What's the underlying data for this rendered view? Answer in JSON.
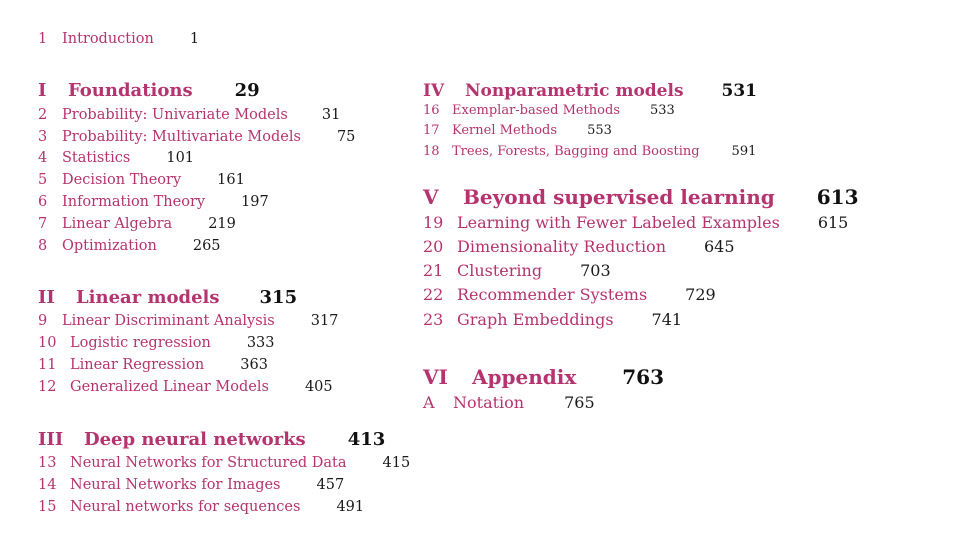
{
  "intro": {
    "num": "1",
    "title": "Introduction",
    "page": "1"
  },
  "parts": {
    "p1": {
      "num": "I",
      "title": "Foundations",
      "page": "29",
      "chapters": [
        {
          "num": "2",
          "title": "Probability: Univariate Models",
          "page": "31"
        },
        {
          "num": "3",
          "title": "Probability: Multivariate Models",
          "page": "75"
        },
        {
          "num": "4",
          "title": "Statistics",
          "page": "101"
        },
        {
          "num": "5",
          "title": "Decision Theory",
          "page": "161"
        },
        {
          "num": "6",
          "title": "Information Theory",
          "page": "197"
        },
        {
          "num": "7",
          "title": "Linear Algebra",
          "page": "219"
        },
        {
          "num": "8",
          "title": "Optimization",
          "page": "265"
        }
      ]
    },
    "p2": {
      "num": "II",
      "title": "Linear models",
      "page": "315",
      "chapters": [
        {
          "num": "9",
          "title": "Linear Discriminant Analysis",
          "page": "317"
        },
        {
          "num": "10",
          "title": "Logistic regression",
          "page": "333"
        },
        {
          "num": "11",
          "title": "Linear Regression",
          "page": "363"
        },
        {
          "num": "12",
          "title": "Generalized Linear Models",
          "page": "405"
        }
      ]
    },
    "p3": {
      "num": "III",
      "title": "Deep neural networks",
      "page": "413",
      "chapters": [
        {
          "num": "13",
          "title": "Neural Networks for Structured Data",
          "page": "415"
        },
        {
          "num": "14",
          "title": "Neural Networks for Images",
          "page": "457"
        },
        {
          "num": "15",
          "title": "Neural networks for sequences",
          "page": "491"
        }
      ]
    },
    "p4": {
      "num": "IV",
      "title": "Nonparametric models",
      "page": "531",
      "chapters": [
        {
          "num": "16",
          "title": "Exemplar-based Methods",
          "page": "533"
        },
        {
          "num": "17",
          "title": "Kernel Methods",
          "page": "553"
        },
        {
          "num": "18",
          "title": "Trees, Forests, Bagging and Boosting",
          "page": "591"
        }
      ]
    },
    "p5": {
      "num": "V",
      "title": "Beyond supervised learning",
      "page": "613",
      "chapters": [
        {
          "num": "19",
          "title": "Learning with Fewer Labeled Examples",
          "page": "615"
        },
        {
          "num": "20",
          "title": "Dimensionality Reduction",
          "page": "645"
        },
        {
          "num": "21",
          "title": "Clustering",
          "page": "703"
        },
        {
          "num": "22",
          "title": "Recommender Systems",
          "page": "729"
        },
        {
          "num": "23",
          "title": "Graph Embeddings",
          "page": "741"
        }
      ]
    },
    "p6": {
      "num": "VI",
      "title": "Appendix",
      "page": "763",
      "chapters": [
        {
          "num": "A",
          "title": "Notation",
          "page": "765"
        }
      ]
    }
  },
  "colors": {
    "accent": "#b5336f",
    "text": "#1a1a1a"
  }
}
